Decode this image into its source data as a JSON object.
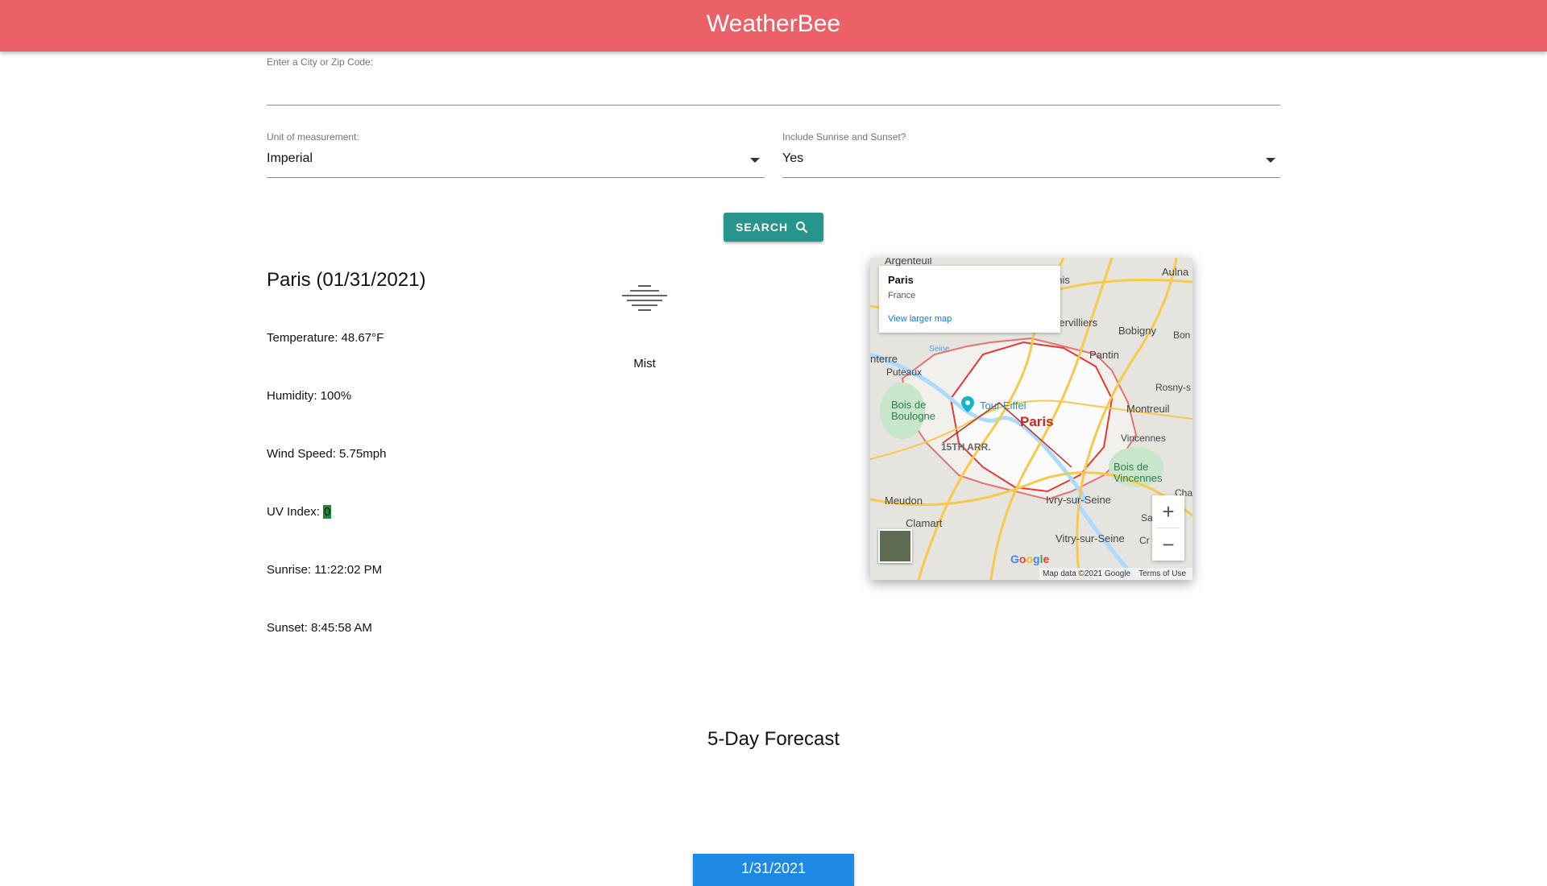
{
  "app": {
    "title": "WeatherBee",
    "bar_color": "#ec6167"
  },
  "search": {
    "label": "Enter a City or Zip Code:",
    "value": "",
    "units_label": "Unit of measurement:",
    "units_value": "Imperial",
    "sun_label": "Include Sunrise and Sunset?",
    "sun_value": "Yes",
    "button_label": "SEARCH",
    "button_icon": "search-icon",
    "button_color": "#26958c"
  },
  "current": {
    "city_title": "Paris (01/31/2021)",
    "temperature": "Temperature: 48.67°F",
    "humidity": "Humidity: 100%",
    "wind": "Wind Speed: 5.75mph",
    "uv_label": "UV Index: ",
    "uv_value": "0",
    "uv_color": "#1e8a3a",
    "sunrise": "Sunrise: 11:22:02 PM",
    "sunset": "Sunset: 8:45:58 AM",
    "condition": "Mist",
    "condition_icon": "mist-icon"
  },
  "map": {
    "info_title": "Paris",
    "info_subtitle": "France",
    "info_link": "View larger map",
    "city_label": "Paris",
    "places": {
      "argenteuil": "Argenteuil",
      "aulna": "Aulna",
      "enis": "enis",
      "aubervilliers": "ubervilliers",
      "bobigny": "Bobigny",
      "bon": "Bon",
      "pantin": "Pantin",
      "nterre": "nterre",
      "puteaux": "Puteaux",
      "rosny": "Rosny-s",
      "montreuil": "Montreuil",
      "bois_boulogne": "Bois de\nBoulogne",
      "tour_eiffel": "Tour Eiffel",
      "vincennes": "Vincennes",
      "bois_vincennes": "Bois de\nVincennes",
      "arr15": "15TH ARR.",
      "meudon": "Meudon",
      "clamart": "Clamart",
      "ivry": "Ivry-sur-Seine",
      "vitry": "Vitry-sur-Seine",
      "cha": "Cha",
      "sai": "Sai",
      "cr": "Cr",
      "seine": "Seine"
    },
    "google_logo": "Google",
    "attribution": "Map data ©2021 Google",
    "terms": "Terms of Use",
    "zoom_in": "+",
    "zoom_out": "−"
  },
  "forecast": {
    "title": "5-Day Forecast",
    "first_day": "1/31/2021",
    "card_color": "#1e88e5"
  }
}
